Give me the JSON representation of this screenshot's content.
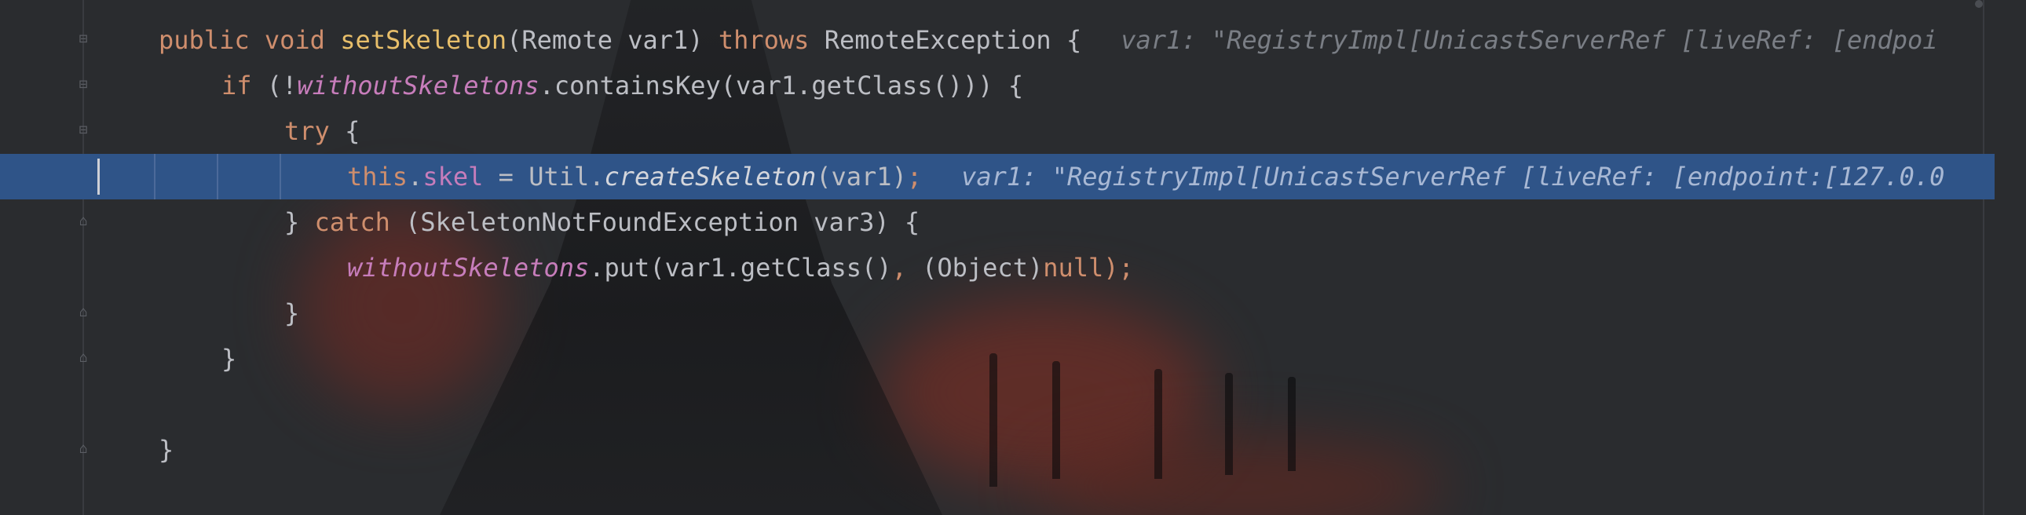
{
  "editor": {
    "lines": [
      {
        "tokens": [
          {
            "t": "public ",
            "c": "kw"
          },
          {
            "t": "void ",
            "c": "kw"
          },
          {
            "t": "setSkeleton",
            "c": "decl"
          },
          {
            "t": "(Remote var1) ",
            "c": "plain"
          },
          {
            "t": "throws ",
            "c": "kw"
          },
          {
            "t": "RemoteException {",
            "c": "plain"
          }
        ],
        "indent": 0,
        "hint": "var1: \"RegistryImpl[UnicastServerRef [liveRef: [endpoi"
      },
      {
        "tokens": [
          {
            "t": "if ",
            "c": "kw"
          },
          {
            "t": "(!",
            "c": "plain"
          },
          {
            "t": "withoutSkeletons",
            "c": "sfield"
          },
          {
            "t": ".containsKey(var1.getClass())) {",
            "c": "plain"
          }
        ],
        "indent": 1,
        "hint": ""
      },
      {
        "tokens": [
          {
            "t": "try ",
            "c": "kw"
          },
          {
            "t": "{",
            "c": "plain"
          }
        ],
        "indent": 2,
        "hint": ""
      },
      {
        "tokens": [
          {
            "t": "this",
            "c": "kw"
          },
          {
            "t": ".",
            "c": "plain"
          },
          {
            "t": "skel",
            "c": "field"
          },
          {
            "t": " = Util.",
            "c": "plain"
          },
          {
            "t": "createSkeleton",
            "c": "smeth"
          },
          {
            "t": "(var1)",
            "c": "plain"
          },
          {
            "t": ";",
            "c": "kw"
          }
        ],
        "indent": 3,
        "hint": "var1: \"RegistryImpl[UnicastServerRef [liveRef: [endpoint:[127.0.0",
        "current": true
      },
      {
        "tokens": [
          {
            "t": "} ",
            "c": "plain"
          },
          {
            "t": "catch ",
            "c": "kw"
          },
          {
            "t": "(SkeletonNotFoundException var3) {",
            "c": "plain"
          }
        ],
        "indent": 2,
        "hint": ""
      },
      {
        "tokens": [
          {
            "t": "withoutSkeletons",
            "c": "sfield"
          },
          {
            "t": ".put(var1.getClass()",
            "c": "plain"
          },
          {
            "t": ", ",
            "c": "kw"
          },
          {
            "t": "(Object)",
            "c": "plain"
          },
          {
            "t": "null",
            "c": "kw"
          },
          {
            "t": ");",
            "c": "kw"
          }
        ],
        "indent": 3,
        "hint": ""
      },
      {
        "tokens": [
          {
            "t": "}",
            "c": "plain"
          }
        ],
        "indent": 2,
        "hint": ""
      },
      {
        "tokens": [
          {
            "t": "}",
            "c": "plain"
          }
        ],
        "indent": 1,
        "hint": ""
      },
      {
        "tokens": [],
        "indent": 0,
        "hint": ""
      },
      {
        "tokens": [
          {
            "t": "}",
            "c": "plain"
          }
        ],
        "indent": 0,
        "hint": ""
      }
    ]
  }
}
